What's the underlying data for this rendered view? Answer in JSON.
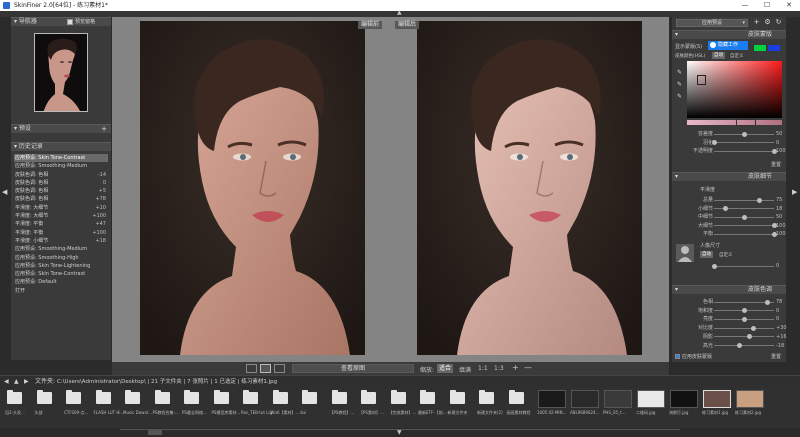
{
  "window": {
    "title": "SkinFiner 2.0[64位] - 练习素材1*",
    "minimize": "—",
    "maximize": "☐",
    "close": "✕"
  },
  "left_panel": {
    "navigator_title": "导航器",
    "preview_checkbox_label": "预览窗格",
    "presets_title": "预设",
    "presets_add": "+",
    "history_title": "历史记录",
    "history": [
      {
        "label": "应用预设: Skin Tone-Contrast",
        "value": ""
      },
      {
        "label": "应用预设: Smoothing-Medium",
        "value": ""
      },
      {
        "label": "皮肤色调: 色相",
        "value": "-14"
      },
      {
        "label": "皮肤色调: 色相",
        "value": "0"
      },
      {
        "label": "皮肤色调: 色相",
        "value": "+5"
      },
      {
        "label": "皮肤色调: 色相",
        "value": "+78"
      },
      {
        "label": "平滑度: 大细节",
        "value": "+10"
      },
      {
        "label": "平滑度: 大细节",
        "value": "+100"
      },
      {
        "label": "平滑度: 平衡",
        "value": "+47"
      },
      {
        "label": "平滑度: 平衡",
        "value": "+100"
      },
      {
        "label": "平滑度: 小细节",
        "value": "+18"
      },
      {
        "label": "应用预设: Smoothing-Medium",
        "value": ""
      },
      {
        "label": "应用预设: Smoothing-High",
        "value": ""
      },
      {
        "label": "应用预设: Skin Tone-Lightening",
        "value": ""
      },
      {
        "label": "应用预设: Skin Tone-Contrast",
        "value": ""
      },
      {
        "label": "应用预设: Default",
        "value": ""
      },
      {
        "label": "打开",
        "value": ""
      }
    ]
  },
  "center": {
    "before_label": "编辑前",
    "after_label": "编辑后",
    "view_button": "查看原图",
    "zoom_label": "缩放:",
    "zoom_fit": "适合",
    "zoom_fill": "填满",
    "zoom_ratio": "1:1",
    "zoom_ratio2": "1:3",
    "zoom_plus": "+",
    "zoom_minus": "—"
  },
  "right_panel": {
    "preset_select": "应用预设",
    "skin_mask_title": "皮肤蒙版",
    "show_mask_label": "显示蒙版(S)",
    "mask_tooltip": "隐藏工作",
    "skin_color_label": "皮肤颜色(HSL)",
    "auto_label": "自动",
    "custom_label": "自定义",
    "mask_sliders": [
      {
        "label": "容差度",
        "value": "50",
        "pos": 0.5
      },
      {
        "label": "羽化",
        "value": "0",
        "pos": 0.0
      },
      {
        "label": "不透明度",
        "value": "100",
        "pos": 1.0
      }
    ],
    "reset_label": "重置",
    "detail_title": "皮肤细节",
    "smooth_label": "平滑度",
    "detail_sliders": [
      {
        "label": "总量",
        "value": "75",
        "pos": 0.75
      },
      {
        "label": "小细节",
        "value": "18",
        "pos": 0.18
      },
      {
        "label": "中细节",
        "value": "50",
        "pos": 0.5
      },
      {
        "label": "大细节",
        "value": "100",
        "pos": 1.0
      },
      {
        "label": "平衡",
        "value": "100",
        "pos": 1.0
      }
    ],
    "person_size_label": "人像尺寸",
    "person_auto": "自动",
    "person_custom": "自定义",
    "person_slider": {
      "label": "",
      "value": "0",
      "pos": 0.0
    },
    "tone_title": "皮肤色调",
    "tone_sliders": [
      {
        "label": "色相",
        "value": "78",
        "pos": 0.89
      },
      {
        "label": "饱和度",
        "value": "0",
        "pos": 0.5
      },
      {
        "label": "亮度",
        "value": "0",
        "pos": 0.5
      },
      {
        "label": "对比度",
        "value": "+30",
        "pos": 0.65
      },
      {
        "label": "阴影",
        "value": "+16",
        "pos": 0.58
      },
      {
        "label": "高光",
        "value": "-18",
        "pos": 0.41
      }
    ],
    "apply_mask_label": "应用皮肤蒙版",
    "reset_label2": "重置"
  },
  "status": {
    "path_label": "文件夹:",
    "path": "C:\\Users\\Administrator\\Desktop\\ | 21 子文件夹 | 7 张照片 | 1 已选定 | 练习素材1.jpg"
  },
  "filmstrip": {
    "folders": [
      "回2-头发...",
      "头部",
      "CTFS09-点...",
      "FLASH LUT Hi...",
      "Music Downl...",
      "PS教程合集-...",
      "PS最全网络...",
      "PS模型库素材...",
      "Res_TEB-tut Lig...",
      "Wn6【素材】...",
      "dui",
      "【PS教程】...",
      "【PS素材】...",
      "【完成素材】...",
      "最新ETF-【前...",
      "新建文件夹",
      "新建文件夹(2)",
      "画画素材教程"
    ],
    "images": [
      "1005 02-MIN...",
      "ABL9689024...",
      "PHS_05_t...",
      "二维码.jpg",
      "海鲜打.jpg",
      "练习素材1.jpg",
      "练习素材2.jpg"
    ]
  },
  "colors": {
    "accent_blue": "#2a84d8",
    "tooltip_blue": "#1a7cf0",
    "green_swatch": "#00d03c",
    "blue_swatch": "#1a3ee0"
  }
}
